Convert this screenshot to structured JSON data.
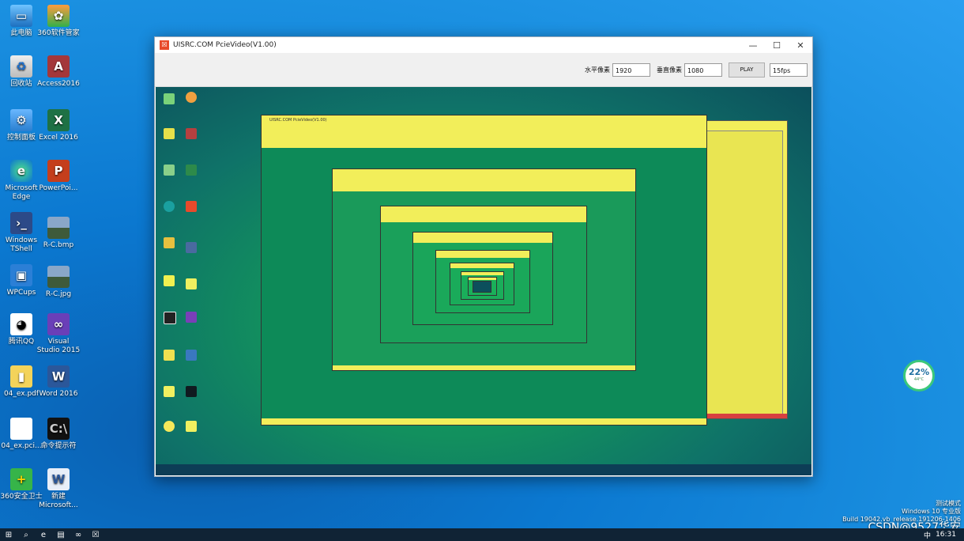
{
  "desktop": {
    "icons": [
      {
        "label": "此电脑",
        "glyph": "▭"
      },
      {
        "label": "360软件管家",
        "glyph": "✿"
      },
      {
        "label": "回收站",
        "glyph": "♻"
      },
      {
        "label": "Access2016",
        "glyph": "A"
      },
      {
        "label": "控制面板",
        "glyph": "⚙"
      },
      {
        "label": "Excel 2016",
        "glyph": "X"
      },
      {
        "label": "Microsoft Edge",
        "glyph": "e"
      },
      {
        "label": "PowerPoi...",
        "glyph": "P"
      },
      {
        "label": "Windows TShell",
        "glyph": "›_"
      },
      {
        "label": "R-C.bmp",
        "glyph": ""
      },
      {
        "label": "WPCups",
        "glyph": "▣"
      },
      {
        "label": "R-C.jpg",
        "glyph": ""
      },
      {
        "label": "腾讯QQ",
        "glyph": "◕"
      },
      {
        "label": "Visual Studio 2015",
        "glyph": "∞"
      },
      {
        "label": "04_ex.pdf",
        "glyph": "▮"
      },
      {
        "label": "Word 2016",
        "glyph": "W"
      },
      {
        "label": "04_ex.pci...",
        "glyph": ""
      },
      {
        "label": "命令提示符",
        "glyph": "C:\\"
      },
      {
        "label": "360安全卫士",
        "glyph": "+"
      },
      {
        "label": "新建 Microsoft...",
        "glyph": "W"
      }
    ]
  },
  "app": {
    "title": "UISRC.COM PcieVideo(V1.00)",
    "logo_glyph": "☒",
    "controls": {
      "minimize": "—",
      "maximize": "☐",
      "close": "✕"
    },
    "toolbar": {
      "h_label": "水平像素",
      "h_value": "1920",
      "v_label": "垂直像素",
      "v_value": "1080",
      "play_label": "PLAY",
      "fps_value": "15fps"
    },
    "nested_title": "UISRC.COM PcieVideo(V1.00)"
  },
  "monitor_gauge": {
    "percent": "22%",
    "temperature": "44°C"
  },
  "watermark": {
    "line1": "测试模式",
    "line2": "Windows 10 专业版",
    "line3": "Build 19042.vb_release.191206-1406"
  },
  "csdn_label": "CSDN@9527华安",
  "taskbar": {
    "tray_ime": "中",
    "time": "16:31",
    "items": [
      "⊞",
      "⌕",
      "e",
      "▤",
      "∞",
      "☒"
    ]
  },
  "colors": {
    "desktop_blue": "#0b78d0",
    "video_yellow": "#f2ee5a",
    "video_green": "#12905e",
    "taskbar": "#102335"
  }
}
